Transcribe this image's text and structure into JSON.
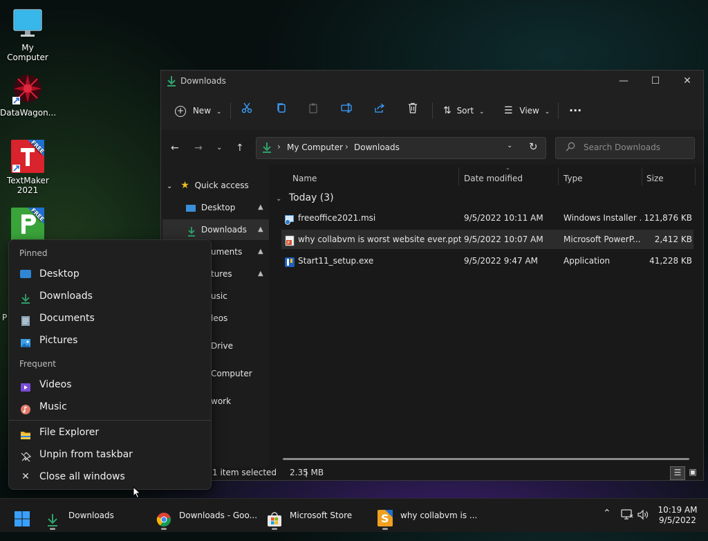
{
  "desktop": {
    "icons": [
      {
        "label": "My Computer"
      },
      {
        "label": "DataWagon..."
      },
      {
        "label": "TextMaker 2021"
      },
      {
        "label": "P"
      }
    ],
    "free_badge": "FREE"
  },
  "explorer": {
    "title": "Downloads",
    "toolbar": {
      "new_label": "New",
      "sort_label": "Sort",
      "view_label": "View",
      "more_label": "..."
    },
    "address": {
      "crumbs": [
        "My Computer",
        "Downloads"
      ]
    },
    "search": {
      "placeholder": "Search Downloads"
    },
    "nav": {
      "quick_access": "Quick access",
      "items": [
        {
          "label": "Desktop",
          "pinned": true
        },
        {
          "label": "Downloads",
          "pinned": true
        },
        {
          "label": "uments",
          "pinned": true
        },
        {
          "label": "tures",
          "pinned": true
        },
        {
          "label": "usic"
        },
        {
          "label": "leos"
        },
        {
          "label": "Drive"
        },
        {
          "label": "Computer"
        },
        {
          "label": "work"
        }
      ]
    },
    "columns": {
      "name": "Name",
      "date": "Date modified",
      "type": "Type",
      "size": "Size"
    },
    "group_label": "Today (3)",
    "files": [
      {
        "name": "freeoffice2021.msi",
        "date": "9/5/2022 10:11 AM",
        "type": "Windows Installer ...",
        "size": "121,876 KB"
      },
      {
        "name": "why collabvm is worst website ever.pptx",
        "date": "9/5/2022 10:07 AM",
        "type": "Microsoft PowerP...",
        "size": "2,412 KB",
        "selected": true
      },
      {
        "name": "Start11_setup.exe",
        "date": "9/5/2022 9:47 AM",
        "type": "Application",
        "size": "41,228 KB"
      }
    ],
    "status": {
      "selection": "1 item selected",
      "size": "2.35 MB",
      "cursor": "|"
    }
  },
  "jumplist": {
    "pinned_header": "Pinned",
    "pinned": [
      "Desktop",
      "Downloads",
      "Documents",
      "Pictures"
    ],
    "frequent_header": "Frequent",
    "frequent": [
      "Videos",
      "Music"
    ],
    "actions": [
      "File Explorer",
      "Unpin from taskbar",
      "Close all windows"
    ]
  },
  "taskbar": {
    "items": [
      {
        "label": "Downloads"
      },
      {
        "label": "Downloads - Goo..."
      },
      {
        "label": "Microsoft Store"
      },
      {
        "label": "why collabvm is ..."
      }
    ],
    "clock": {
      "time": "10:19 AM",
      "date": "9/5/2022"
    },
    "tray_chevron": "^"
  },
  "colors": {
    "accent_green": "#2ea36b",
    "win_blue": "#3aa0ff",
    "window_bg": "#191919"
  }
}
